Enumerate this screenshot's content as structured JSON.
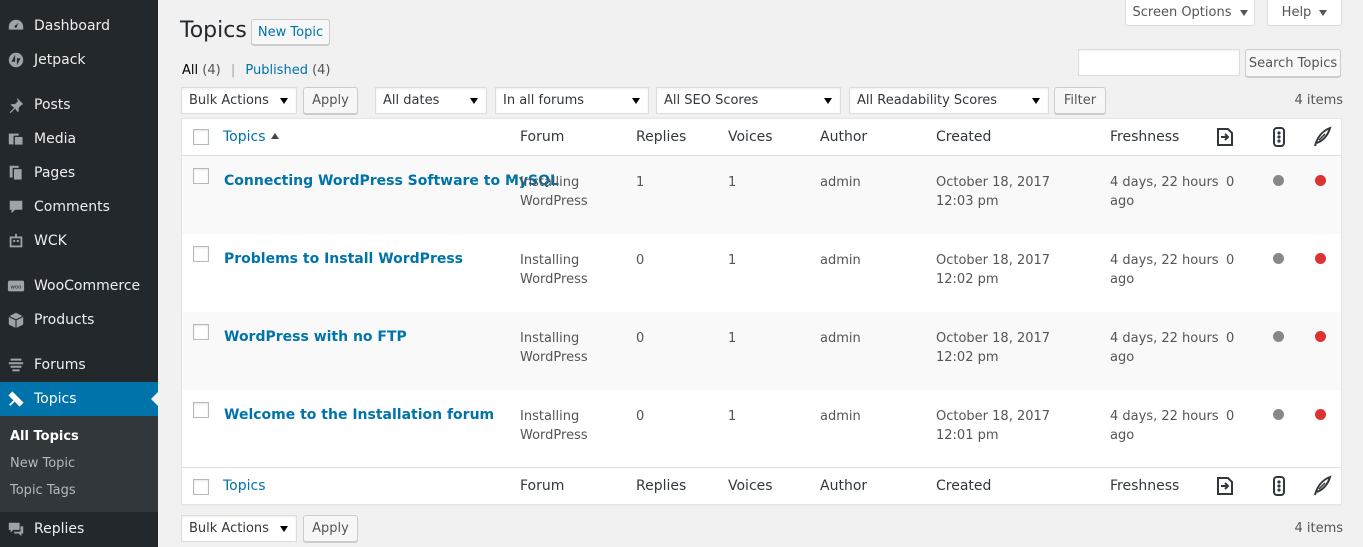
{
  "sidebar": {
    "items": [
      {
        "label": "Dashboard",
        "icon": "dashboard-icon"
      },
      {
        "label": "Jetpack",
        "icon": "jetpack-icon"
      },
      {
        "label": "Posts",
        "icon": "pin-icon"
      },
      {
        "label": "Media",
        "icon": "media-icon"
      },
      {
        "label": "Pages",
        "icon": "pages-icon"
      },
      {
        "label": "Comments",
        "icon": "comments-icon"
      },
      {
        "label": "WCK",
        "icon": "robot-icon"
      },
      {
        "label": "WooCommerce",
        "icon": "woocommerce-icon"
      },
      {
        "label": "Products",
        "icon": "box-icon"
      },
      {
        "label": "Forums",
        "icon": "forums-icon"
      },
      {
        "label": "Topics",
        "icon": "topics-icon"
      },
      {
        "label": "Replies",
        "icon": "replies-icon"
      }
    ],
    "submenu": [
      "All Topics",
      "New Topic",
      "Topic Tags"
    ]
  },
  "header": {
    "title": "Topics",
    "new_button": "New Topic",
    "screen_options": "Screen Options",
    "help": "Help"
  },
  "views": {
    "all_label": "All",
    "all_count": "(4)",
    "separator": "|",
    "published_label": "Published",
    "published_count": "(4)"
  },
  "search": {
    "button": "Search Topics",
    "value": ""
  },
  "filters": {
    "bulk_actions": "Bulk Actions",
    "apply": "Apply",
    "dates": "All dates",
    "forums": "In all forums",
    "seo": "All SEO Scores",
    "readability": "All Readability Scores",
    "filter": "Filter",
    "items_count": "4 items"
  },
  "table": {
    "columns": [
      "Topics",
      "Forum",
      "Replies",
      "Voices",
      "Author",
      "Created",
      "Freshness"
    ],
    "column_icons": [
      "comment-count-icon",
      "seo-score-icon",
      "readability-icon"
    ],
    "rows": [
      {
        "title": "Connecting WordPress Software to MySQL",
        "forum_line1": "Installing",
        "forum_line2": "WordPress",
        "replies": "1",
        "voices": "1",
        "author": "admin",
        "created_date": "October 18, 2017",
        "created_time": "12:03 pm",
        "freshness_line1": "4 days, 22 hours",
        "freshness_line2": "ago",
        "comments": "0"
      },
      {
        "title": "Problems to Install WordPress",
        "forum_line1": "Installing",
        "forum_line2": "WordPress",
        "replies": "0",
        "voices": "1",
        "author": "admin",
        "created_date": "October 18, 2017",
        "created_time": "12:02 pm",
        "freshness_line1": "4 days, 22 hours",
        "freshness_line2": "ago",
        "comments": "0"
      },
      {
        "title": "WordPress with no FTP",
        "forum_line1": "Installing",
        "forum_line2": "WordPress",
        "replies": "0",
        "voices": "1",
        "author": "admin",
        "created_date": "October 18, 2017",
        "created_time": "12:02 pm",
        "freshness_line1": "4 days, 22 hours",
        "freshness_line2": "ago",
        "comments": "0"
      },
      {
        "title": "Welcome to the Installation forum",
        "forum_line1": "Installing",
        "forum_line2": "WordPress",
        "replies": "0",
        "voices": "1",
        "author": "admin",
        "created_date": "October 18, 2017",
        "created_time": "12:01 pm",
        "freshness_line1": "4 days, 22 hours",
        "freshness_line2": "ago",
        "comments": "0"
      }
    ]
  },
  "colors": {
    "sidebar": "#23282d",
    "accent": "#0073aa",
    "seo_dot": "#888888",
    "readability_dot": "#dc3232"
  }
}
